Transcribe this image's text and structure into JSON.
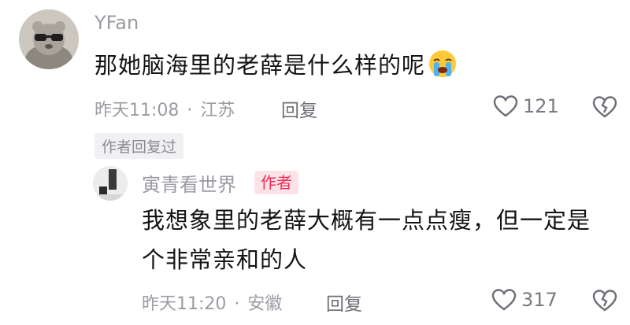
{
  "comment": {
    "username": "YFan",
    "content": "那她脑海里的老薛是什么样的呢",
    "emoji": "crying-face-icon",
    "time": "昨天11:08",
    "location": "江苏",
    "separator": "·",
    "reply_label": "回复",
    "likes": "121",
    "author_replied_label": "作者回复过"
  },
  "reply": {
    "username": "寅青看世界",
    "author_badge": "作者",
    "content_line1": "我想象里的老薛大概有一点点瘦，但一定是",
    "content_line2": "个非常亲和的人",
    "time": "昨天11:20",
    "location": "安徽",
    "separator": "·",
    "reply_label": "回复",
    "likes": "317"
  },
  "colors": {
    "text_primary": "#141414",
    "text_secondary": "#9b9ba3",
    "author_badge_text": "#f02d54",
    "author_badge_bg": "#fde3e8"
  }
}
